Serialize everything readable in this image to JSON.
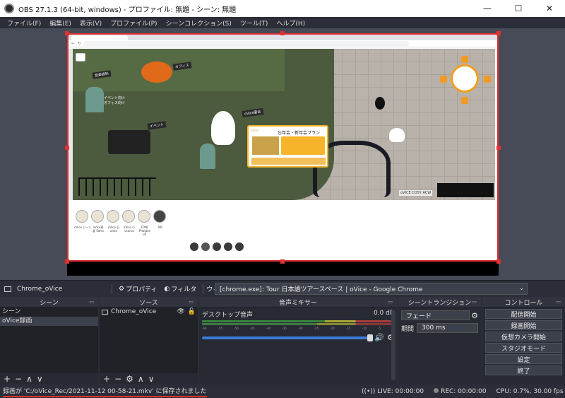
{
  "window": {
    "title": "OBS 27.1.3 (64-bit, windows) - プロファイル: 無題 - シーン: 無題",
    "minimize": "—",
    "maximize": "☐",
    "close": "✕"
  },
  "menu": [
    "ファイル(F)",
    "編集(E)",
    "表示(V)",
    "プロファイル(P)",
    "シーンコレクション(S)",
    "ツール(T)",
    "ヘルプ(H)"
  ],
  "preview": {
    "map_labels": {
      "sign_1": "音楽資料",
      "sign_2": "オフィス",
      "sign_3": "イベント",
      "sign_4": "oVice宴会",
      "grave_text": "イベント向け\nオフィス向け",
      "banner_brand": "oVice",
      "banner_head": "忘年会・新年会プラン",
      "corner_label": "oVICE COSY ACW"
    },
    "participants": [
      {
        "name": "oVice ジーン"
      },
      {
        "name": "oVice東\n倉 Sales"
      },
      {
        "name": "oVice 石\nanoo"
      },
      {
        "name": "oVice 小\nosaruo"
      },
      {
        "name": "【ON】\nPhatake\nv4"
      },
      {
        "name": "ND"
      }
    ]
  },
  "source_toolbar": {
    "source_name": "Chrome_oVice",
    "properties": "プロパティ",
    "filters": "フィルタ",
    "window_label": "ウィンドウ",
    "window_value": "[chrome.exe]: Tour 日本語ツアースペース | oVice - Google Chrome"
  },
  "scenes": {
    "title": "シーン",
    "items": [
      "シーン",
      "oVice録画"
    ],
    "selected_index": 1
  },
  "sources": {
    "title": "ソース",
    "items": [
      {
        "name": "Chrome_oVice"
      }
    ]
  },
  "mixer": {
    "title": "音声ミキサー",
    "track": {
      "name": "デスクトップ音声",
      "level": "0.0 dB"
    },
    "scale": [
      "-60",
      "-55",
      "-50",
      "-45",
      "-40",
      "-35",
      "-30",
      "-25",
      "-20",
      "-15",
      "-10",
      "-5",
      "0"
    ],
    "volume_fraction": 1.0
  },
  "transitions": {
    "title": "シーントランジション",
    "selected": "フェード",
    "duration_label": "期間",
    "duration_value": "300 ms"
  },
  "controls": {
    "title": "コントロール",
    "buttons": [
      "配信開始",
      "録画開始",
      "仮想カメラ開始",
      "スタジオモード",
      "設定",
      "終了"
    ]
  },
  "status": {
    "message": "録画が 'C:/oVice_Rec/2021-11-12 00-58-21.mkv' に保存されました",
    "live": "LIVE: 00:00:00",
    "rec": "REC: 00:00:00",
    "cpu": "CPU: 0.7%, 30.00 fps"
  },
  "colors": {
    "accent_red": "#e03030",
    "panel_bg": "#2b2e38",
    "slider_blue": "#3b7bd8"
  }
}
